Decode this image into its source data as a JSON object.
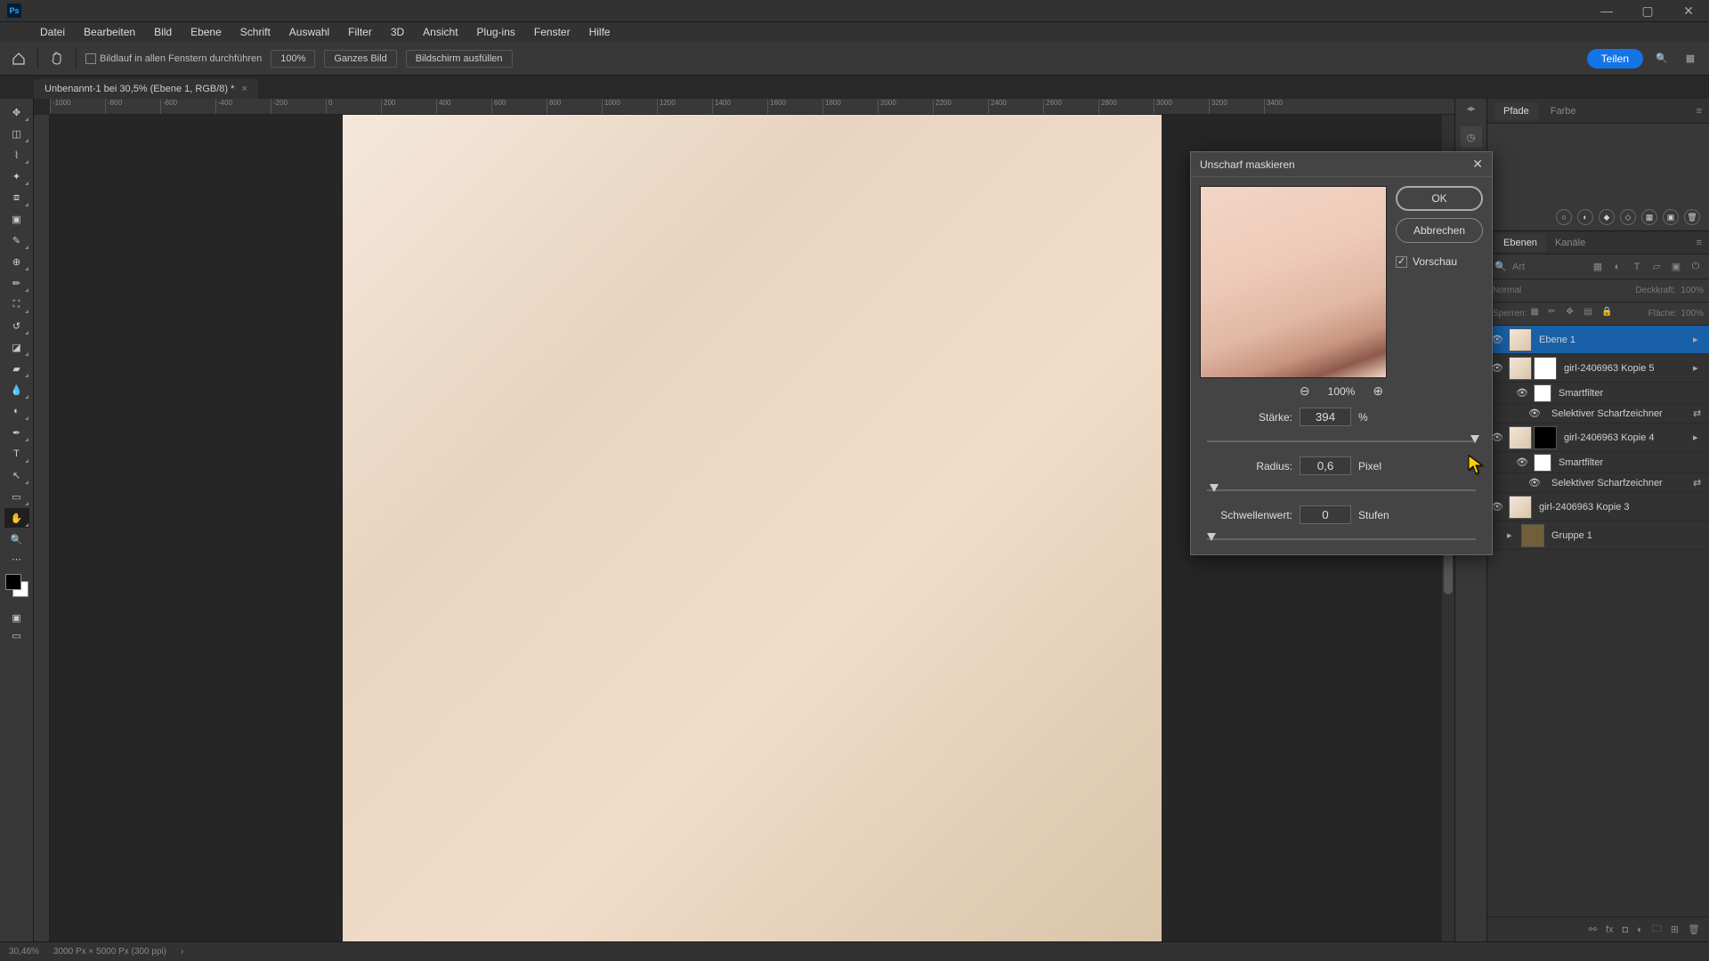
{
  "app": {
    "ps": "Ps"
  },
  "menu": [
    "Datei",
    "Bearbeiten",
    "Bild",
    "Ebene",
    "Schrift",
    "Auswahl",
    "Filter",
    "3D",
    "Ansicht",
    "Plug-ins",
    "Fenster",
    "Hilfe"
  ],
  "options": {
    "scroll_all": "Bildlauf in allen Fenstern durchführen",
    "p100": "100%",
    "fit": "Ganzes Bild",
    "fill": "Bildschirm ausfüllen",
    "share": "Teilen"
  },
  "doc": {
    "tab": "Unbenannt-1 bei 30,5% (Ebene 1, RGB/8) *"
  },
  "ruler": [
    "-1000",
    "-800",
    "-600",
    "-400",
    "-200",
    "0",
    "200",
    "400",
    "600",
    "800",
    "1000",
    "1200",
    "1400",
    "1600",
    "1800",
    "2000",
    "2200",
    "2400",
    "2600",
    "2800",
    "3000",
    "3200",
    "3400"
  ],
  "panels": {
    "pfade": "Pfade",
    "farbe": "Farbe",
    "ebenen": "Ebenen",
    "kanaele": "Kanäle",
    "blend": "Normal",
    "opacity_label": "Deckkraft:",
    "opacity": "100%",
    "lock_label": "Sperren:",
    "fill_label": "Fläche:",
    "fill": "100%",
    "search_hint": "Art"
  },
  "layers": {
    "l1": "Ebene 1",
    "l2": "girl-2406963 Kopie 5",
    "sf": "Smartfilter",
    "ss": "Selektiver Scharfzeichner",
    "l3": "girl-2406963 Kopie 4",
    "l4": "girl-2406963 Kopie 3",
    "grp": "Gruppe 1"
  },
  "dialog": {
    "title": "Unscharf maskieren",
    "ok": "OK",
    "cancel": "Abbrechen",
    "preview": "Vorschau",
    "zoom": "100%",
    "strength_label": "Stärke:",
    "strength": "394",
    "strength_unit": "%",
    "radius_label": "Radius:",
    "radius": "0,6",
    "radius_unit": "Pixel",
    "threshold_label": "Schwellenwert:",
    "threshold": "0",
    "threshold_unit": "Stufen"
  },
  "status": {
    "zoom": "30,46%",
    "dims": "3000 Px × 5000 Px (300 ppi)"
  }
}
